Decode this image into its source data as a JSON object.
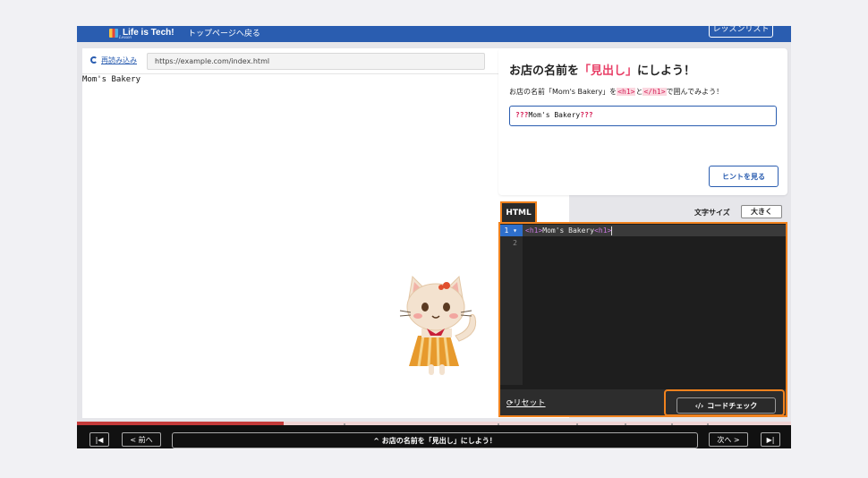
{
  "header": {
    "logo_text": "Life is Tech!",
    "logo_sub": "Lesson",
    "back_link": "トップページへ戻る",
    "lesson_list": "レッスンリスト"
  },
  "preview": {
    "reload_label": "再読み込み",
    "url": "https://example.com/index.html",
    "content": "Mom's Bakery"
  },
  "task": {
    "title_prefix": "お店の名前を",
    "title_highlight": "「見出し」",
    "title_suffix": "にしよう！",
    "desc_a": "お店の名前「Mom's Bakery」を",
    "tag_open": "<h1>",
    "desc_b": "と",
    "tag_close": "</h1>",
    "desc_c": "で囲んでみよう！",
    "box_q1": "???",
    "box_text": "Mom's Bakery",
    "box_q2": "???",
    "hint_button": "ヒントを見る"
  },
  "editor": {
    "tab_label": "HTML",
    "fontsize_label": "文字サイズ",
    "fontsize_button": "大きく",
    "lines": [
      {
        "num": "1",
        "open": "<h1>",
        "text": "Mom's Bakery",
        "close": "<h1>"
      },
      {
        "num": "2"
      }
    ],
    "reset_label": "リセット",
    "check_button": "コードチェック"
  },
  "progress": {
    "fraction": 0.29
  },
  "footer": {
    "first_btn": "|◀",
    "prev_btn": "< 前へ",
    "lesson_title": "^ お店の名前を「見出し」にしよう！",
    "next_btn": "次へ >",
    "last_btn": "▶|"
  },
  "colors": {
    "brand": "#2a5db0",
    "accent": "#e83e66",
    "highlight_border": "#f0821e",
    "progress": "#c43b3b"
  }
}
